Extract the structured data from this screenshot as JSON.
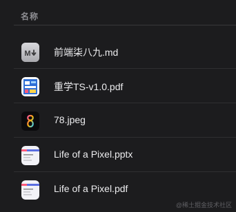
{
  "header": {
    "name_column": "名称"
  },
  "files": [
    {
      "name": "前端柒八九.md",
      "icon": "markdown-file-icon"
    },
    {
      "name": "重学TS-v1.0.pdf",
      "icon": "pdf-thumbnail-icon"
    },
    {
      "name": "78.jpeg",
      "icon": "image-thumbnail-icon"
    },
    {
      "name": "Life of a Pixel.pptx",
      "icon": "slides-thumbnail-icon"
    },
    {
      "name": "Life of a Pixel.pdf",
      "icon": "pdf-slides-thumbnail-icon"
    }
  ],
  "watermark": "@稀土掘金技术社区",
  "colors": {
    "background": "#1c1c1e",
    "text": "#ececee",
    "header_text": "#8e8e93",
    "divider": "#2f2f31"
  }
}
